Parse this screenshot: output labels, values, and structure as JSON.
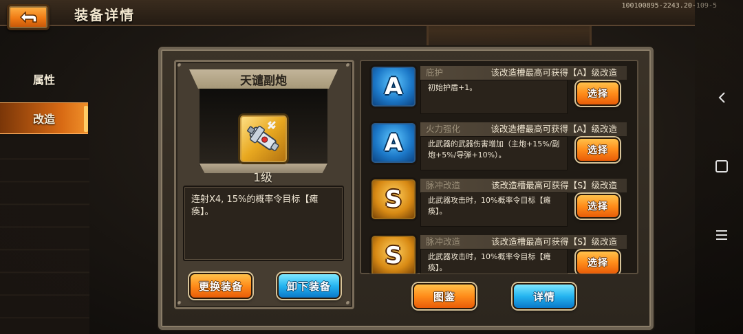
{
  "header": {
    "title": "装备详情",
    "version": "100100895-2243.20-109-5"
  },
  "nav": {
    "items": [
      {
        "label": "属性"
      },
      {
        "label": "改造"
      }
    ],
    "active_index": 1
  },
  "equipment": {
    "name": "天谴副炮",
    "level": "1级",
    "description": "连射X4, 15%的概率令目标【瘫痪】。",
    "buttons": {
      "change": "更换装备",
      "unequip": "卸下装备"
    }
  },
  "slots": [
    {
      "badge": "A",
      "name": "庇护",
      "cap": "该改造槽最高可获得【A】级改造",
      "desc": "初始护盾+1。",
      "select": "选择"
    },
    {
      "badge": "A",
      "name": "火力强化",
      "cap": "该改造槽最高可获得【A】级改造",
      "desc": "此武器的武器伤害增加（主炮+15%/副炮+5%/导弹+10%）。",
      "select": "选择"
    },
    {
      "badge": "S",
      "name": "脉冲改造",
      "cap": "该改造槽最高可获得【S】级改造",
      "desc": "此武器攻击时，10%概率令目标【瘫痪】。",
      "select": "选择"
    },
    {
      "badge": "S",
      "name": "脉冲改造",
      "cap": "该改造槽最高可获得【S】级改造",
      "desc": "此武器攻击时，10%概率令目标【瘫痪】。",
      "select": "选择"
    }
  ],
  "footer": {
    "codex": "图鉴",
    "detail": "详情"
  },
  "colors": {
    "accent_orange": "#ff8c1a",
    "accent_blue": "#25b4f0",
    "panel": "#3b3328"
  },
  "icons": [
    "back-arrow-icon",
    "cannon-icon",
    "android-back-icon",
    "android-home-icon",
    "android-menu-icon"
  ]
}
